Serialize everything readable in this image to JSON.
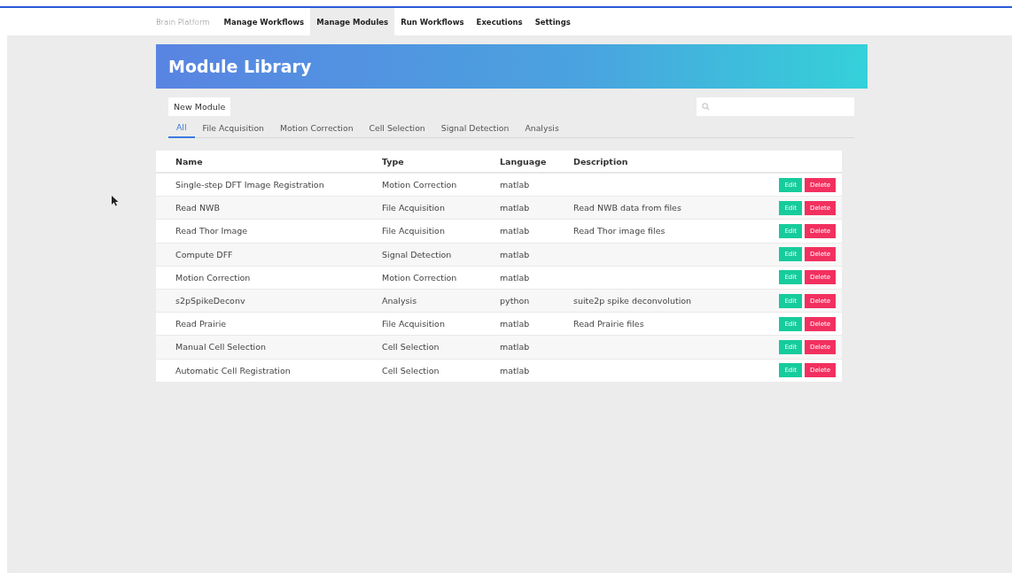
{
  "nav": {
    "brand": "Brain Platform",
    "items": [
      {
        "label": "Manage Workflows",
        "selected": false
      },
      {
        "label": "Manage Modules",
        "selected": true
      },
      {
        "label": "Run Workflows",
        "selected": false
      },
      {
        "label": "Executions",
        "selected": false
      },
      {
        "label": "Settings",
        "selected": false
      }
    ]
  },
  "header": {
    "title": "Module Library"
  },
  "new_button": "New Module",
  "filters": [
    {
      "label": "All",
      "selected": true
    },
    {
      "label": "File Acquisition",
      "selected": false
    },
    {
      "label": "Motion Correction",
      "selected": false
    },
    {
      "label": "Cell Selection",
      "selected": false
    },
    {
      "label": "Signal Detection",
      "selected": false
    },
    {
      "label": "Analysis",
      "selected": false
    }
  ],
  "table": {
    "columns": [
      "Name",
      "Type",
      "Language",
      "Description"
    ],
    "rows": [
      {
        "name": "Single-step DFT Image Registration",
        "type": "Motion Correction",
        "language": "matlab",
        "description": "",
        "edit": "Edit",
        "delete": "Delete"
      },
      {
        "name": "Read NWB",
        "type": "File Acquisition",
        "language": "matlab",
        "description": "Read NWB data from files",
        "edit": "Edit",
        "delete": "Delete"
      },
      {
        "name": "Read Thor Image",
        "type": "File Acquisition",
        "language": "matlab",
        "description": "Read Thor image files",
        "edit": "Edit",
        "delete": "Delete"
      },
      {
        "name": "Compute DFF",
        "type": "Signal Detection",
        "language": "matlab",
        "description": "",
        "edit": "Edit",
        "delete": "Delete"
      },
      {
        "name": "Motion Correction",
        "type": "Motion Correction",
        "language": "matlab",
        "description": "",
        "edit": "Edit",
        "delete": "Delete"
      },
      {
        "name": "s2pSpikeDeconv",
        "type": "Analysis",
        "language": "python",
        "description": "suite2p spike deconvolution",
        "edit": "Edit",
        "delete": "Delete"
      },
      {
        "name": "Read Prairie",
        "type": "File Acquisition",
        "language": "matlab",
        "description": "Read Prairie files",
        "edit": "Edit",
        "delete": "Delete"
      },
      {
        "name": "Manual Cell Selection",
        "type": "Cell Selection",
        "language": "matlab",
        "description": "",
        "edit": "Edit",
        "delete": "Delete"
      },
      {
        "name": "Automatic Cell Registration",
        "type": "Cell Selection",
        "language": "matlab",
        "description": "",
        "edit": "Edit",
        "delete": "Delete"
      }
    ]
  }
}
